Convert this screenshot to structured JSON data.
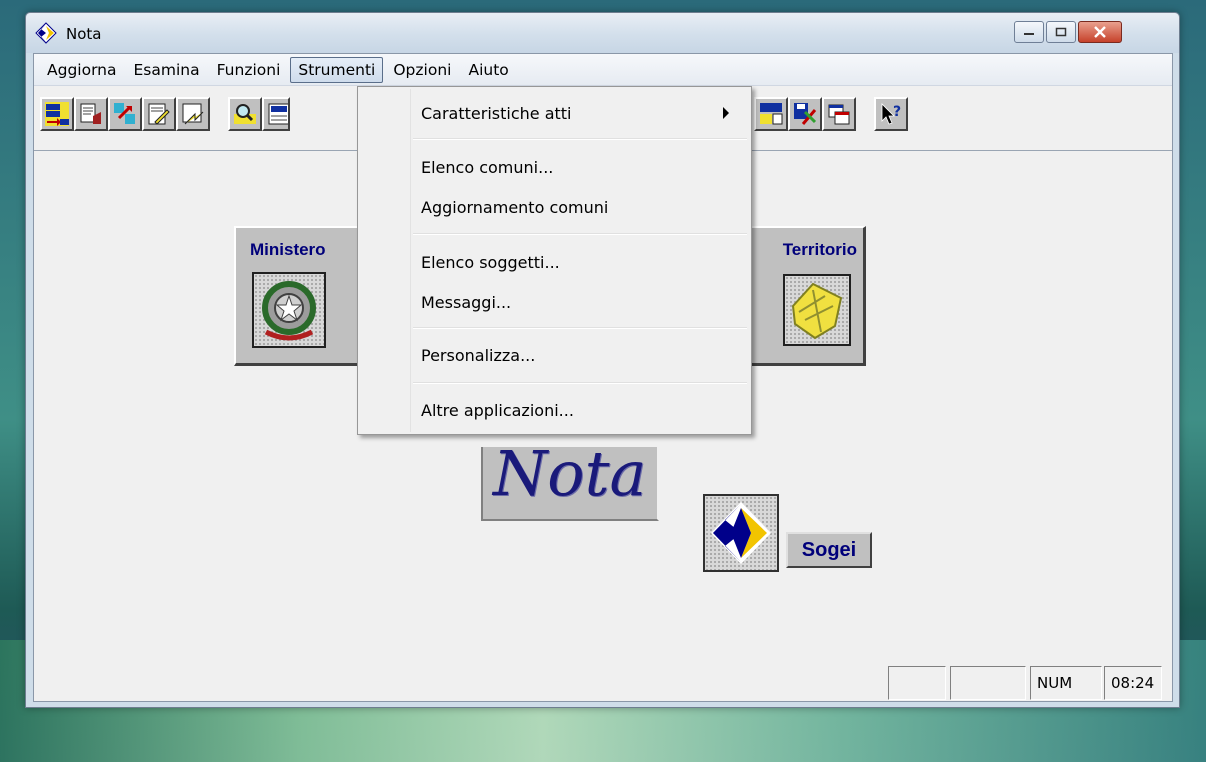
{
  "window": {
    "title": "Nota"
  },
  "menu": {
    "items": [
      "Aggiorna",
      "Esamina",
      "Funzioni",
      "Strumenti",
      "Opzioni",
      "Aiuto"
    ],
    "active": "Strumenti"
  },
  "dropdown": {
    "items": [
      {
        "label": "Caratteristiche atti",
        "submenu": true
      },
      {
        "label": "Elenco comuni..."
      },
      {
        "label": "Aggiornamento comuni"
      },
      {
        "label": "Elenco soggetti..."
      },
      {
        "label": "Messaggi..."
      },
      {
        "label": "Personalizza..."
      },
      {
        "label": "Altre applicazioni..."
      }
    ]
  },
  "toolbar": {
    "buttons": [
      {
        "icon": "nota-nota-icon"
      },
      {
        "icon": "document-icon"
      },
      {
        "icon": "arrows-icon"
      },
      {
        "icon": "form-pen-icon"
      },
      {
        "icon": "form-arrow-icon"
      },
      {
        "icon": "search-doc-icon"
      },
      {
        "icon": "nota-doc-icon"
      },
      {
        "icon": "a1020-icon"
      },
      {
        "icon": "disk-tools-icon"
      },
      {
        "icon": "windows-icon"
      },
      {
        "icon": "context-help-icon"
      }
    ]
  },
  "panel": {
    "left_title": "Ministero",
    "right_title": "Territorio"
  },
  "logo": {
    "nota_text": "Nota",
    "sogei_text": "Sogei"
  },
  "statusbar": {
    "num": "NUM",
    "time": "08:24"
  },
  "colors": {
    "accent": "#00007a",
    "face": "#c0c0c0"
  }
}
